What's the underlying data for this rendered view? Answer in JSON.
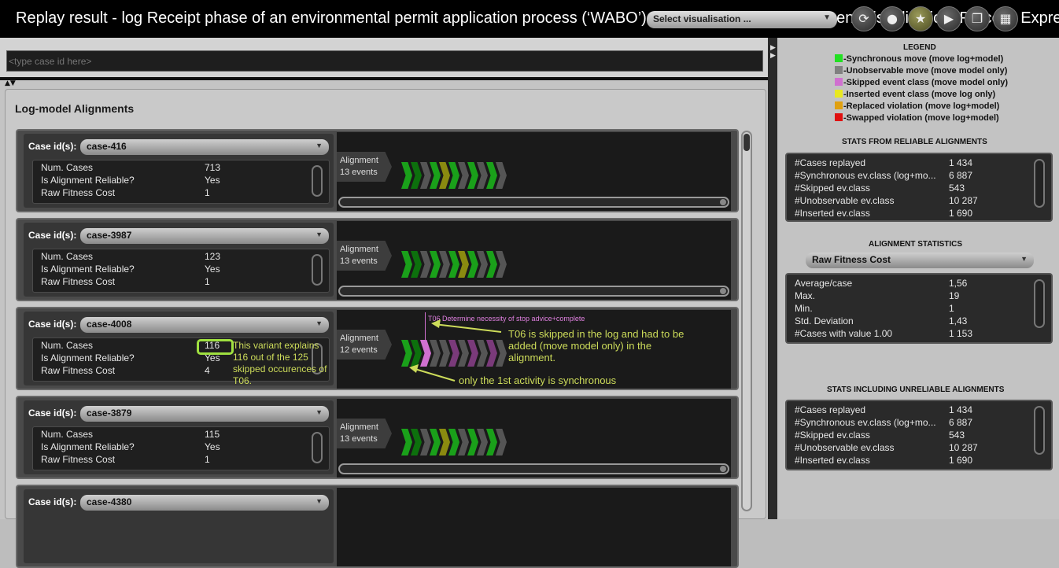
{
  "window": {
    "title": "Replay result - log Receipt phase of an environmental permit application process (‘WABO’), CoSeLoG project : Alignment Visualisation, Process Express"
  },
  "toolbar": {
    "vis_select": "Select visualisation ...",
    "buttons": [
      {
        "icon": "refresh-icon",
        "glyph": "⟳"
      },
      {
        "icon": "drop-icon",
        "glyph": "●"
      },
      {
        "icon": "star-icon",
        "glyph": "★"
      },
      {
        "icon": "play-icon",
        "glyph": "▶"
      },
      {
        "icon": "copy-icon",
        "glyph": "❐"
      },
      {
        "icon": "grid-icon",
        "glyph": "▦"
      }
    ]
  },
  "search": {
    "placeholder": "<type case id here>"
  },
  "main": {
    "heading": "Log-model Alignments"
  },
  "case_label": "Case id(s):",
  "stat_labels": [
    "Num. Cases",
    "Is Alignment Reliable?",
    "Raw Fitness Cost"
  ],
  "alignment_word": "Alignment",
  "cases": [
    {
      "id": "case-416",
      "num_cases": "713",
      "reliable": "Yes",
      "cost": "1",
      "events": "13 events",
      "moves": [
        "#1aa01a",
        "#0d700d",
        "#555555",
        "#1aa01a",
        "#8a8a10",
        "#1aa01a",
        "#555555",
        "#1aa01a",
        "#555555",
        "#1aa01a",
        "#555555"
      ]
    },
    {
      "id": "case-3987",
      "num_cases": "123",
      "reliable": "Yes",
      "cost": "1",
      "events": "13 events",
      "moves": [
        "#1aa01a",
        "#0d700d",
        "#555555",
        "#1aa01a",
        "#555555",
        "#1aa01a",
        "#8a8a10",
        "#1aa01a",
        "#555555",
        "#1aa01a",
        "#555555"
      ]
    },
    {
      "id": "case-4008",
      "num_cases": "116",
      "reliable": "Yes",
      "cost": "4",
      "events": "12 events",
      "moves": [
        "#1aa01a",
        "#0d700d",
        "#d070d0",
        "#555555",
        "#555555",
        "#7a3a7a",
        "#555555",
        "#7a3a7a",
        "#555555",
        "#7a3a7a",
        "#555555"
      ]
    },
    {
      "id": "case-3879",
      "num_cases": "115",
      "reliable": "Yes",
      "cost": "1",
      "events": "13 events",
      "moves": [
        "#1aa01a",
        "#0d700d",
        "#555555",
        "#1aa01a",
        "#8a8a10",
        "#1aa01a",
        "#555555",
        "#1aa01a",
        "#555555",
        "#1aa01a",
        "#555555"
      ]
    },
    {
      "id": "case-4380",
      "num_cases": "",
      "reliable": "",
      "cost": "",
      "events": "",
      "moves": []
    }
  ],
  "annotations": {
    "variant": "This variant explains 116 out of the 125 skipped occurences of T06.",
    "activity_label": "T06 Determine necessity of stop advice+complete",
    "skipped": "T06 is skipped in the log and had to be added (move model only) in the alignment.",
    "first_sync": "only the 1st activity is synchronous"
  },
  "legend": {
    "title": "LEGEND",
    "items": [
      {
        "color": "#22e022",
        "label": "-Synchronous move (move log+model)"
      },
      {
        "color": "#808080",
        "label": "-Unobservable move (move model only)"
      },
      {
        "color": "#d070d0",
        "label": "-Skipped event class (move model only)"
      },
      {
        "color": "#e8e820",
        "label": "-Inserted event class (move log only)"
      },
      {
        "color": "#e0a010",
        "label": "-Replaced violation (move log+model)"
      },
      {
        "color": "#e01010",
        "label": "-Swapped violation (move log+model)"
      }
    ]
  },
  "reliable_stats": {
    "title": "STATS FROM RELIABLE ALIGNMENTS",
    "rows": [
      {
        "label": "#Cases replayed",
        "value": "1 434"
      },
      {
        "label": "#Synchronous ev.class (log+mo...",
        "value": "6 887"
      },
      {
        "label": "#Skipped ev.class",
        "value": "543"
      },
      {
        "label": "#Unobservable ev.class",
        "value": "10 287"
      },
      {
        "label": "#Inserted ev.class",
        "value": "1 690"
      }
    ]
  },
  "alignment_stats": {
    "title": "ALIGNMENT STATISTICS",
    "selector": "Raw Fitness Cost",
    "rows": [
      {
        "label": "Average/case",
        "value": "1,56"
      },
      {
        "label": "Max.",
        "value": "19"
      },
      {
        "label": "Min.",
        "value": "1"
      },
      {
        "label": "Std. Deviation",
        "value": "1,43"
      },
      {
        "label": "#Cases with value 1.00",
        "value": "1 153"
      }
    ]
  },
  "unreliable_stats": {
    "title": "STATS INCLUDING UNRELIABLE ALIGNMENTS",
    "rows": [
      {
        "label": "#Cases replayed",
        "value": "1 434"
      },
      {
        "label": "#Synchronous ev.class (log+mo...",
        "value": "6 887"
      },
      {
        "label": "#Skipped ev.class",
        "value": "543"
      },
      {
        "label": "#Unobservable ev.class",
        "value": "10 287"
      },
      {
        "label": "#Inserted ev.class",
        "value": "1 690"
      }
    ]
  }
}
